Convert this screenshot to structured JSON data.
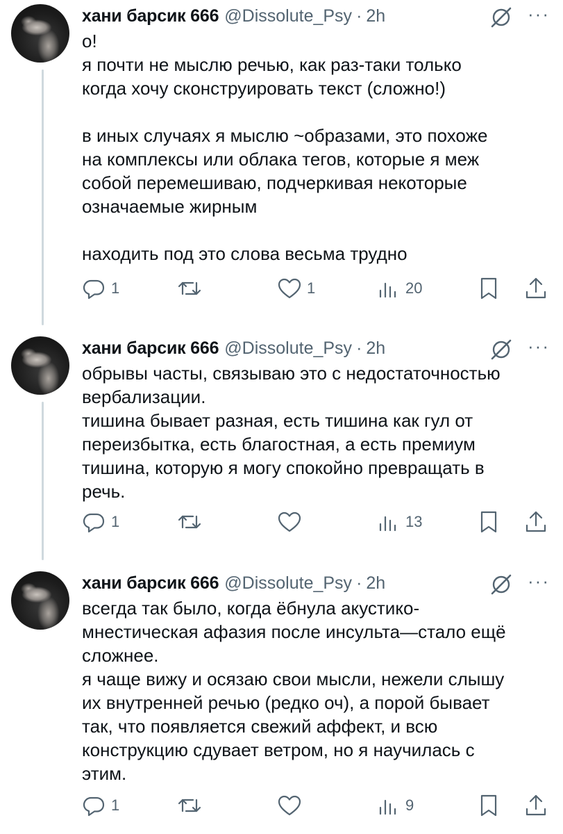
{
  "tweets": [
    {
      "author": {
        "name": "хани барсик 666",
        "handle": "@Dissolute_Psy",
        "separator": "·",
        "time": "2h"
      },
      "text": "о!\nя почти не мыслю речью, как раз-таки только\nкогда хочу сконструировать текст (сложно!)\n\nв иных случаях я мыслю ~образами, это похоже\nна комплексы или облака тегов, которые я меж\nсобой перемешиваю, подчеркивая некоторые\nозначаемые жирным\n\nнаходить под это слова весьма трудно",
      "stats": {
        "replies": "1",
        "reposts": "",
        "likes": "1",
        "views": "20"
      }
    },
    {
      "author": {
        "name": "хани барсик 666",
        "handle": "@Dissolute_Psy",
        "separator": "·",
        "time": "2h"
      },
      "text": "обрывы часты, связываю это с недостаточностью\nвербализации.\nтишина бывает разная, есть тишина как гул от\nпереизбытка, есть благостная, а есть премиум\nтишина, которую я могу спокойно превращать в\nречь.",
      "stats": {
        "replies": "1",
        "reposts": "",
        "likes": "",
        "views": "13"
      }
    },
    {
      "author": {
        "name": "хани барсик 666",
        "handle": "@Dissolute_Psy",
        "separator": "·",
        "time": "2h"
      },
      "text": "всегда так было, когда ёбнула акустико-\nмнестическая афазия после инсульта—стало ещё\nсложнее.\nя чаще вижу и осязаю свои мысли, нежели слышу\nих внутренней речью (редко оч), а порой бывает\nтак, что появляется свежий аффект, и всю\nконструкцию сдувает ветром, но я научилась с\nэтим.",
      "stats": {
        "replies": "1",
        "reposts": "",
        "likes": "",
        "views": "9"
      }
    }
  ],
  "more_glyph": "···",
  "icons": [
    "grok-icon",
    "more-icon",
    "reply-icon",
    "repost-icon",
    "like-icon",
    "views-icon",
    "bookmark-icon",
    "share-icon"
  ]
}
